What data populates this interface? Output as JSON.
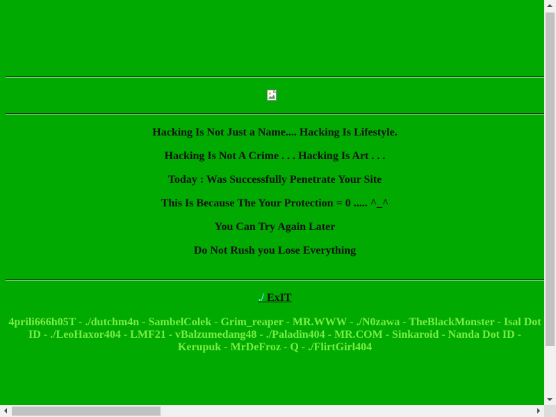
{
  "colors": {
    "background": "#00aa00",
    "text": "#111111",
    "credits_text": "#77ee44",
    "link_slash": "#44ffff"
  },
  "header_image": {
    "icon": "broken-image-icon"
  },
  "messages": [
    "Hacking Is Not Just a Name.... Hacking Is Lifestyle.",
    "Hacking Is Not A Crime . . . Hacking Is Art . . .",
    "Today : Was Successfully Penetrate Your Site",
    "This Is Because The Your Protection = 0 ..... ^_^",
    "You Can Try Again Later",
    "Do Not Rush you Lose Everything"
  ],
  "exit_link": {
    "slash": "./",
    "label": " ExIT"
  },
  "credits": "4prili666h05T - ./dutchm4n - SambelColek - Grim_reaper - MR.WWW - ./N0zawa - TheBlackMonster - Isal Dot ID - ./LeoHaxor404 - LMF21 - vBalzumedang48 - ./Paladin404 - MR.COM - Sinkaroid - Nanda Dot ID - Kerupuk - MrDeFroz - Q - ./FlirtGirl404",
  "scrollbars": {
    "vertical_icon_up": "arrow-up-icon",
    "vertical_icon_down": "arrow-down-icon",
    "horizontal_icon_left": "arrow-left-icon",
    "horizontal_icon_right": "arrow-right-icon"
  }
}
